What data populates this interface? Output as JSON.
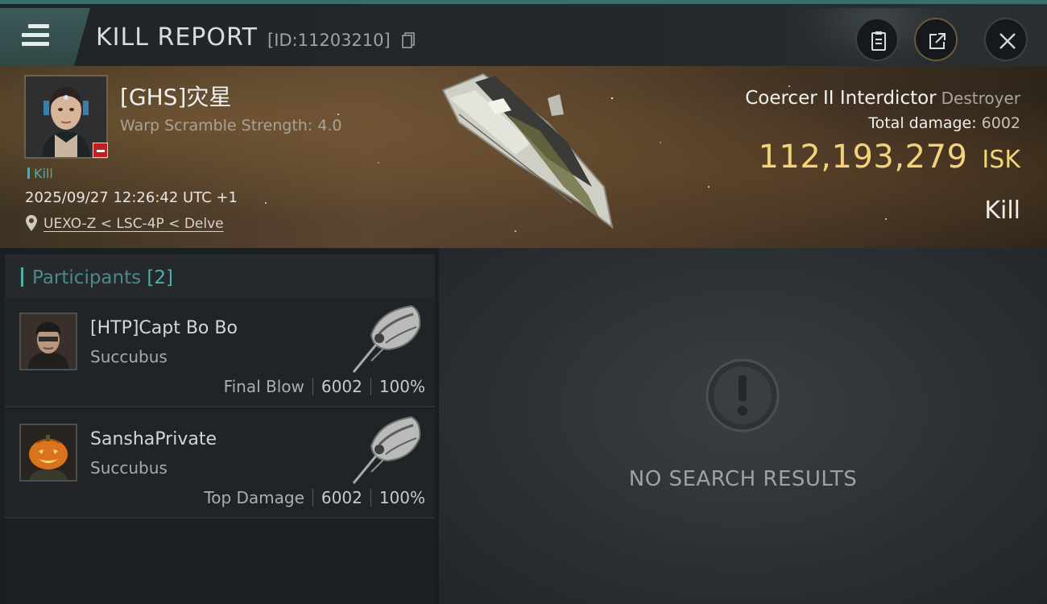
{
  "header": {
    "title": "KILL REPORT",
    "report_id": "[ID:11203210]"
  },
  "victim": {
    "name": "[GHS]灾星",
    "subtitle": "Warp Scramble Strength: 4.0",
    "tag": "Kill",
    "timestamp": "2025/09/27 12:26:42 UTC +1",
    "location": "UEXO-Z < LSC-4P < Delve",
    "ship_name": "Coercer II Interdictor",
    "ship_class": "Destroyer",
    "damage_label": "Total damage:",
    "damage_value": "6002",
    "isk_value": "112,193,279",
    "isk_unit": "ISK",
    "result": "Kill"
  },
  "participants": {
    "title": "Participants",
    "count": "[2]",
    "rows": [
      {
        "name": "[HTP]Capt Bo Bo",
        "ship": "Succubus",
        "role": "Final Blow",
        "damage": "6002",
        "percent": "100%"
      },
      {
        "name": "SanshaPrivate",
        "ship": "Succubus",
        "role": "Top Damage",
        "damage": "6002",
        "percent": "100%"
      }
    ]
  },
  "results_panel": {
    "empty_text": "NO SEARCH RESULTS"
  },
  "colors": {
    "accent_teal": "#4cb1ab",
    "isk_gold": "#f0d37a",
    "flag_red": "#c0201f"
  },
  "icons": [
    "menu-icon",
    "copy-icon",
    "clipboard-icon",
    "share-icon",
    "close-icon",
    "location-pin-icon",
    "ship-icon",
    "warning-icon"
  ]
}
